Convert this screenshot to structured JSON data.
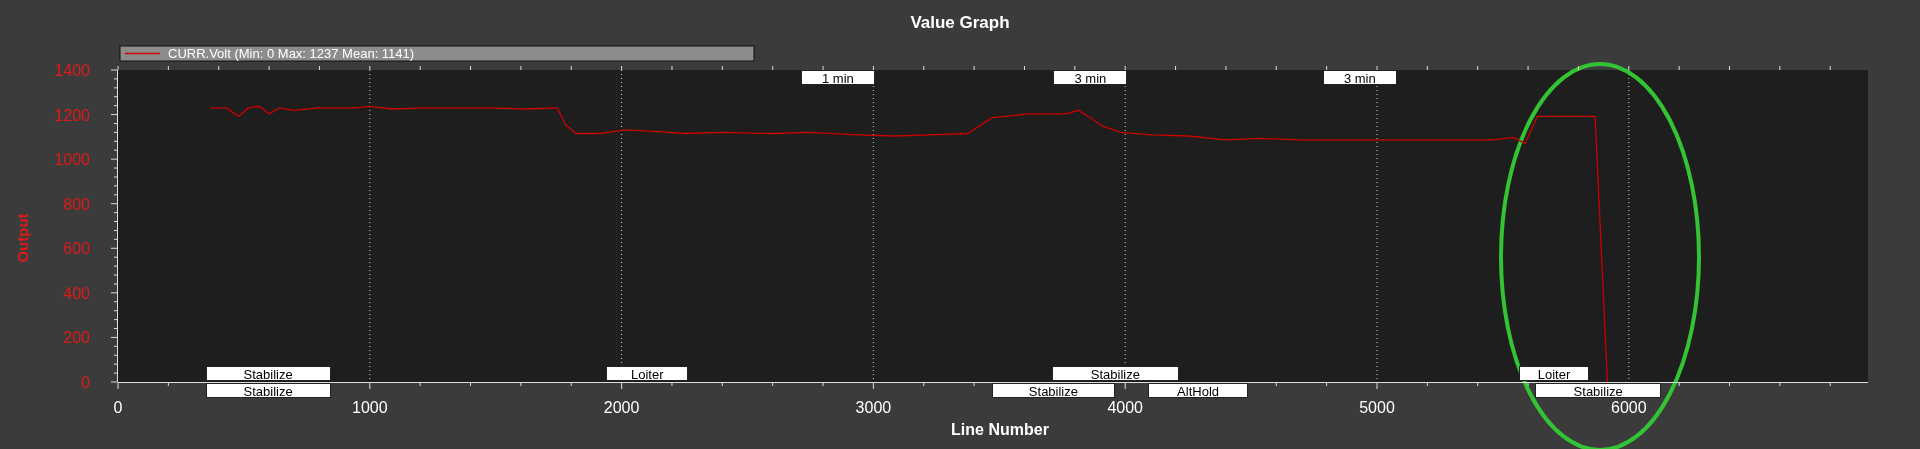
{
  "graph": {
    "legend_stats": "(Min: 0 Max: 1237 Mean: 1141)",
    "chart_data": {
      "type": "line",
      "title": "Value Graph",
      "xlabel": "Line Number",
      "ylabel": "Output",
      "x": [
        367,
        431,
        479,
        518,
        562,
        601,
        640,
        698,
        796,
        942,
        1000,
        1087,
        1234,
        1477,
        1623,
        1744,
        1779,
        1818,
        1915,
        2012,
        2109,
        2255,
        2401,
        2595,
        2741,
        2936,
        3082,
        3228,
        3375,
        3472,
        3618,
        3764,
        3813,
        3862,
        3910,
        3983,
        4105,
        4251,
        4397,
        4543,
        4689,
        4981,
        5273,
        5467,
        5540,
        5588,
        5637,
        5866,
        5915
      ],
      "series": [
        {
          "name": "CURR.Volt",
          "color": "#cc0000",
          "values": [
            1230,
            1230,
            1192,
            1230,
            1237,
            1203,
            1230,
            1219,
            1230,
            1230,
            1237,
            1225,
            1230,
            1230,
            1225,
            1230,
            1153,
            1115,
            1115,
            1131,
            1126,
            1115,
            1120,
            1115,
            1120,
            1109,
            1104,
            1109,
            1115,
            1186,
            1203,
            1203,
            1219,
            1186,
            1148,
            1120,
            1109,
            1104,
            1087,
            1093,
            1087,
            1087,
            1087,
            1087,
            1098,
            1071,
            1192,
            1192,
            0
          ]
        }
      ],
      "xlim": [
        0,
        6950
      ],
      "ylim": [
        0,
        1400
      ],
      "xticks": [
        0,
        1000,
        2000,
        3000,
        4000,
        5000,
        6000
      ],
      "yticks": [
        0,
        200,
        400,
        600,
        800,
        1000,
        1200,
        1400
      ],
      "grid": true
    },
    "time_markers": [
      "1 min",
      "3 min",
      "3 min"
    ],
    "flight_modes_upper": [
      "Stabilize",
      "Loiter",
      "Stabilize",
      "Loiter"
    ],
    "flight_modes_lower": [
      "Stabilize",
      "Stabilize",
      "AltHold",
      "Stabilize"
    ]
  }
}
